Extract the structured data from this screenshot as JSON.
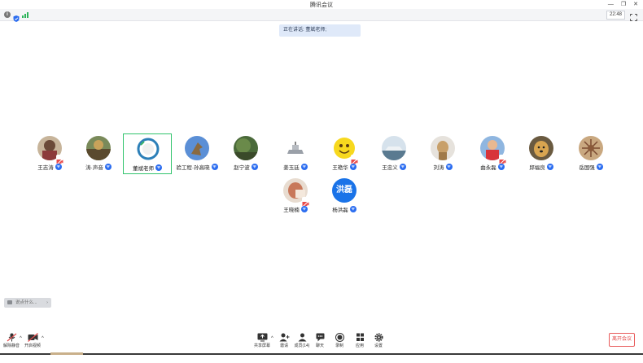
{
  "app": {
    "title": "腾讯会议",
    "time": "22:48"
  },
  "banner": {
    "text": "正在讲话: 董斌老师;"
  },
  "participants": [
    {
      "name": "王志涛"
    },
    {
      "name": "涛·声音"
    },
    {
      "name": "董斌老师"
    },
    {
      "name": "验工程·孙高晓"
    },
    {
      "name": "赵宁波"
    },
    {
      "name": "姜玉廷"
    },
    {
      "name": "王艳华"
    },
    {
      "name": "王忠义"
    },
    {
      "name": "刘涛"
    },
    {
      "name": "曲永磊"
    },
    {
      "name": "邱福良"
    },
    {
      "name": "岳国强"
    },
    {
      "name": "王晓楠"
    },
    {
      "name": "杨洪磊",
      "avatar_text": "洪磊"
    }
  ],
  "chat": {
    "placeholder": "说点什么..."
  },
  "toolbar": {
    "unmute": "解除静音",
    "start_video": "开启视频",
    "share_screen": "共享屏幕",
    "invite": "邀请",
    "members": "成员(14)",
    "chat": "聊天",
    "record": "录制",
    "apps": "应用",
    "settings": "设置",
    "leave": "离开会议"
  },
  "colors": {
    "accent": "#2a6cf0",
    "speaking_border": "#31c46d",
    "leave": "#e24c4c",
    "banner_bg": "#dfe9f9"
  }
}
